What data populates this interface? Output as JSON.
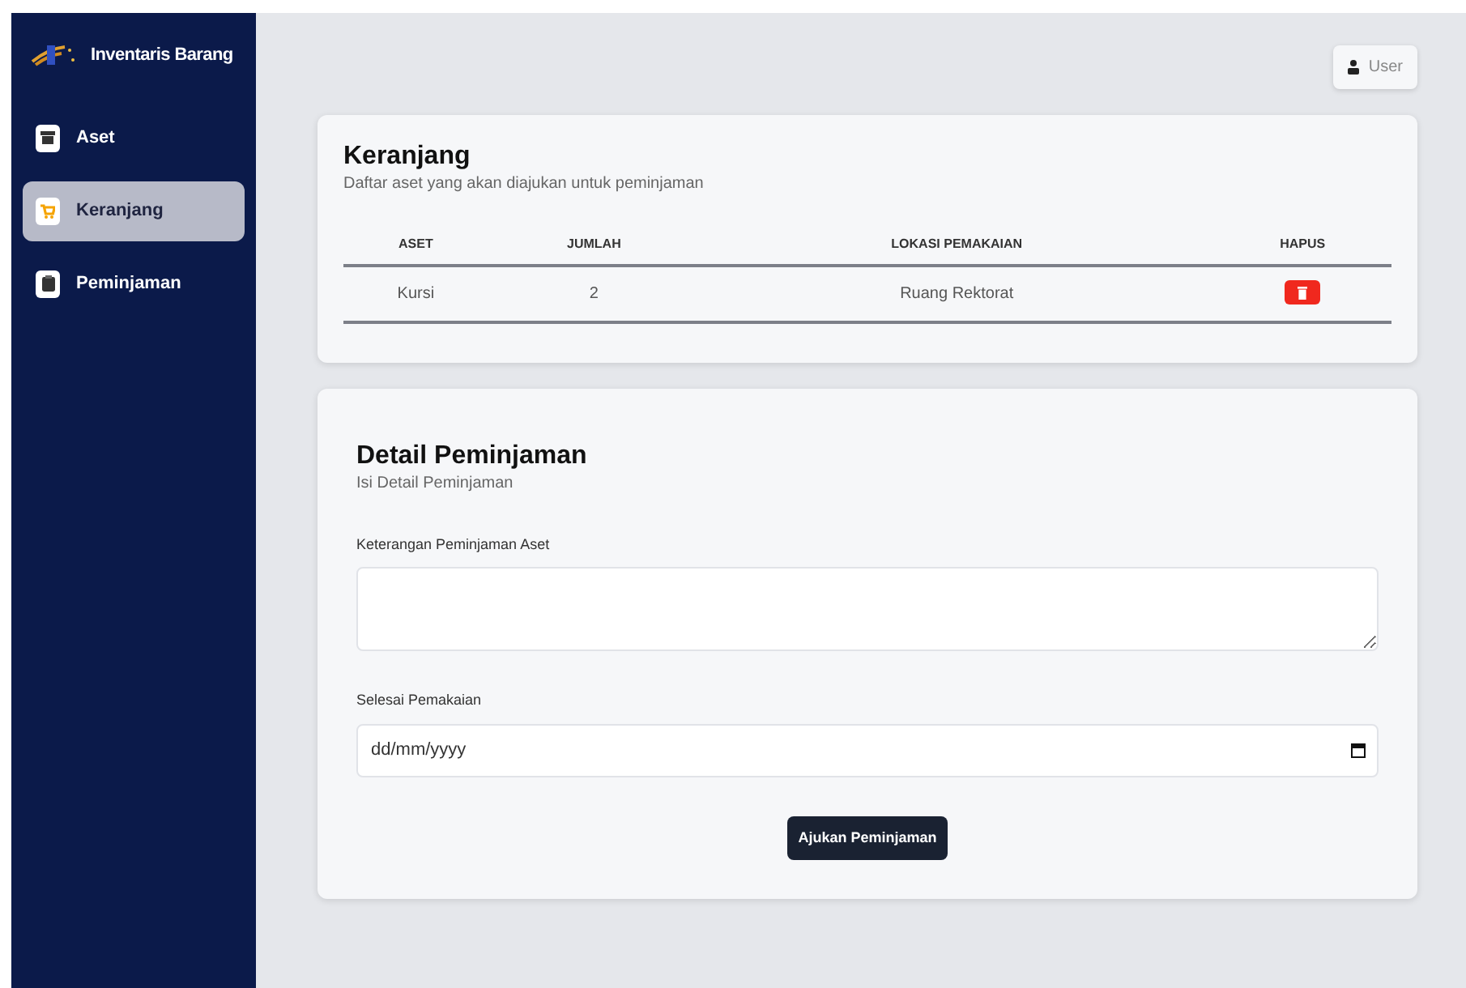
{
  "sidebar": {
    "brand": "Inventaris Barang",
    "items": [
      {
        "label": "Aset",
        "selected": false
      },
      {
        "label": "Keranjang",
        "selected": true
      },
      {
        "label": "Peminjaman",
        "selected": false
      }
    ]
  },
  "user_button": "User",
  "cart": {
    "title": "Keranjang",
    "subtitle": "Daftar aset yang akan diajukan untuk peminjaman",
    "columns": [
      "ASET",
      "JUMLAH",
      "LOKASI PEMAKAIAN",
      "HAPUS"
    ],
    "rows": [
      {
        "aset": "Kursi",
        "jumlah": "2",
        "lokasi": "Ruang Rektorat"
      }
    ]
  },
  "form": {
    "title": "Detail Peminjaman",
    "subtitle": "Isi Detail Peminjaman",
    "fields": [
      {
        "kind": "textarea",
        "label": "Keterangan Peminjaman Aset"
      },
      {
        "kind": "date",
        "label": "Selesai Pemakaian",
        "placeholder": "dd/mm/yyyy"
      }
    ],
    "submit": "Ajukan Peminjaman"
  }
}
